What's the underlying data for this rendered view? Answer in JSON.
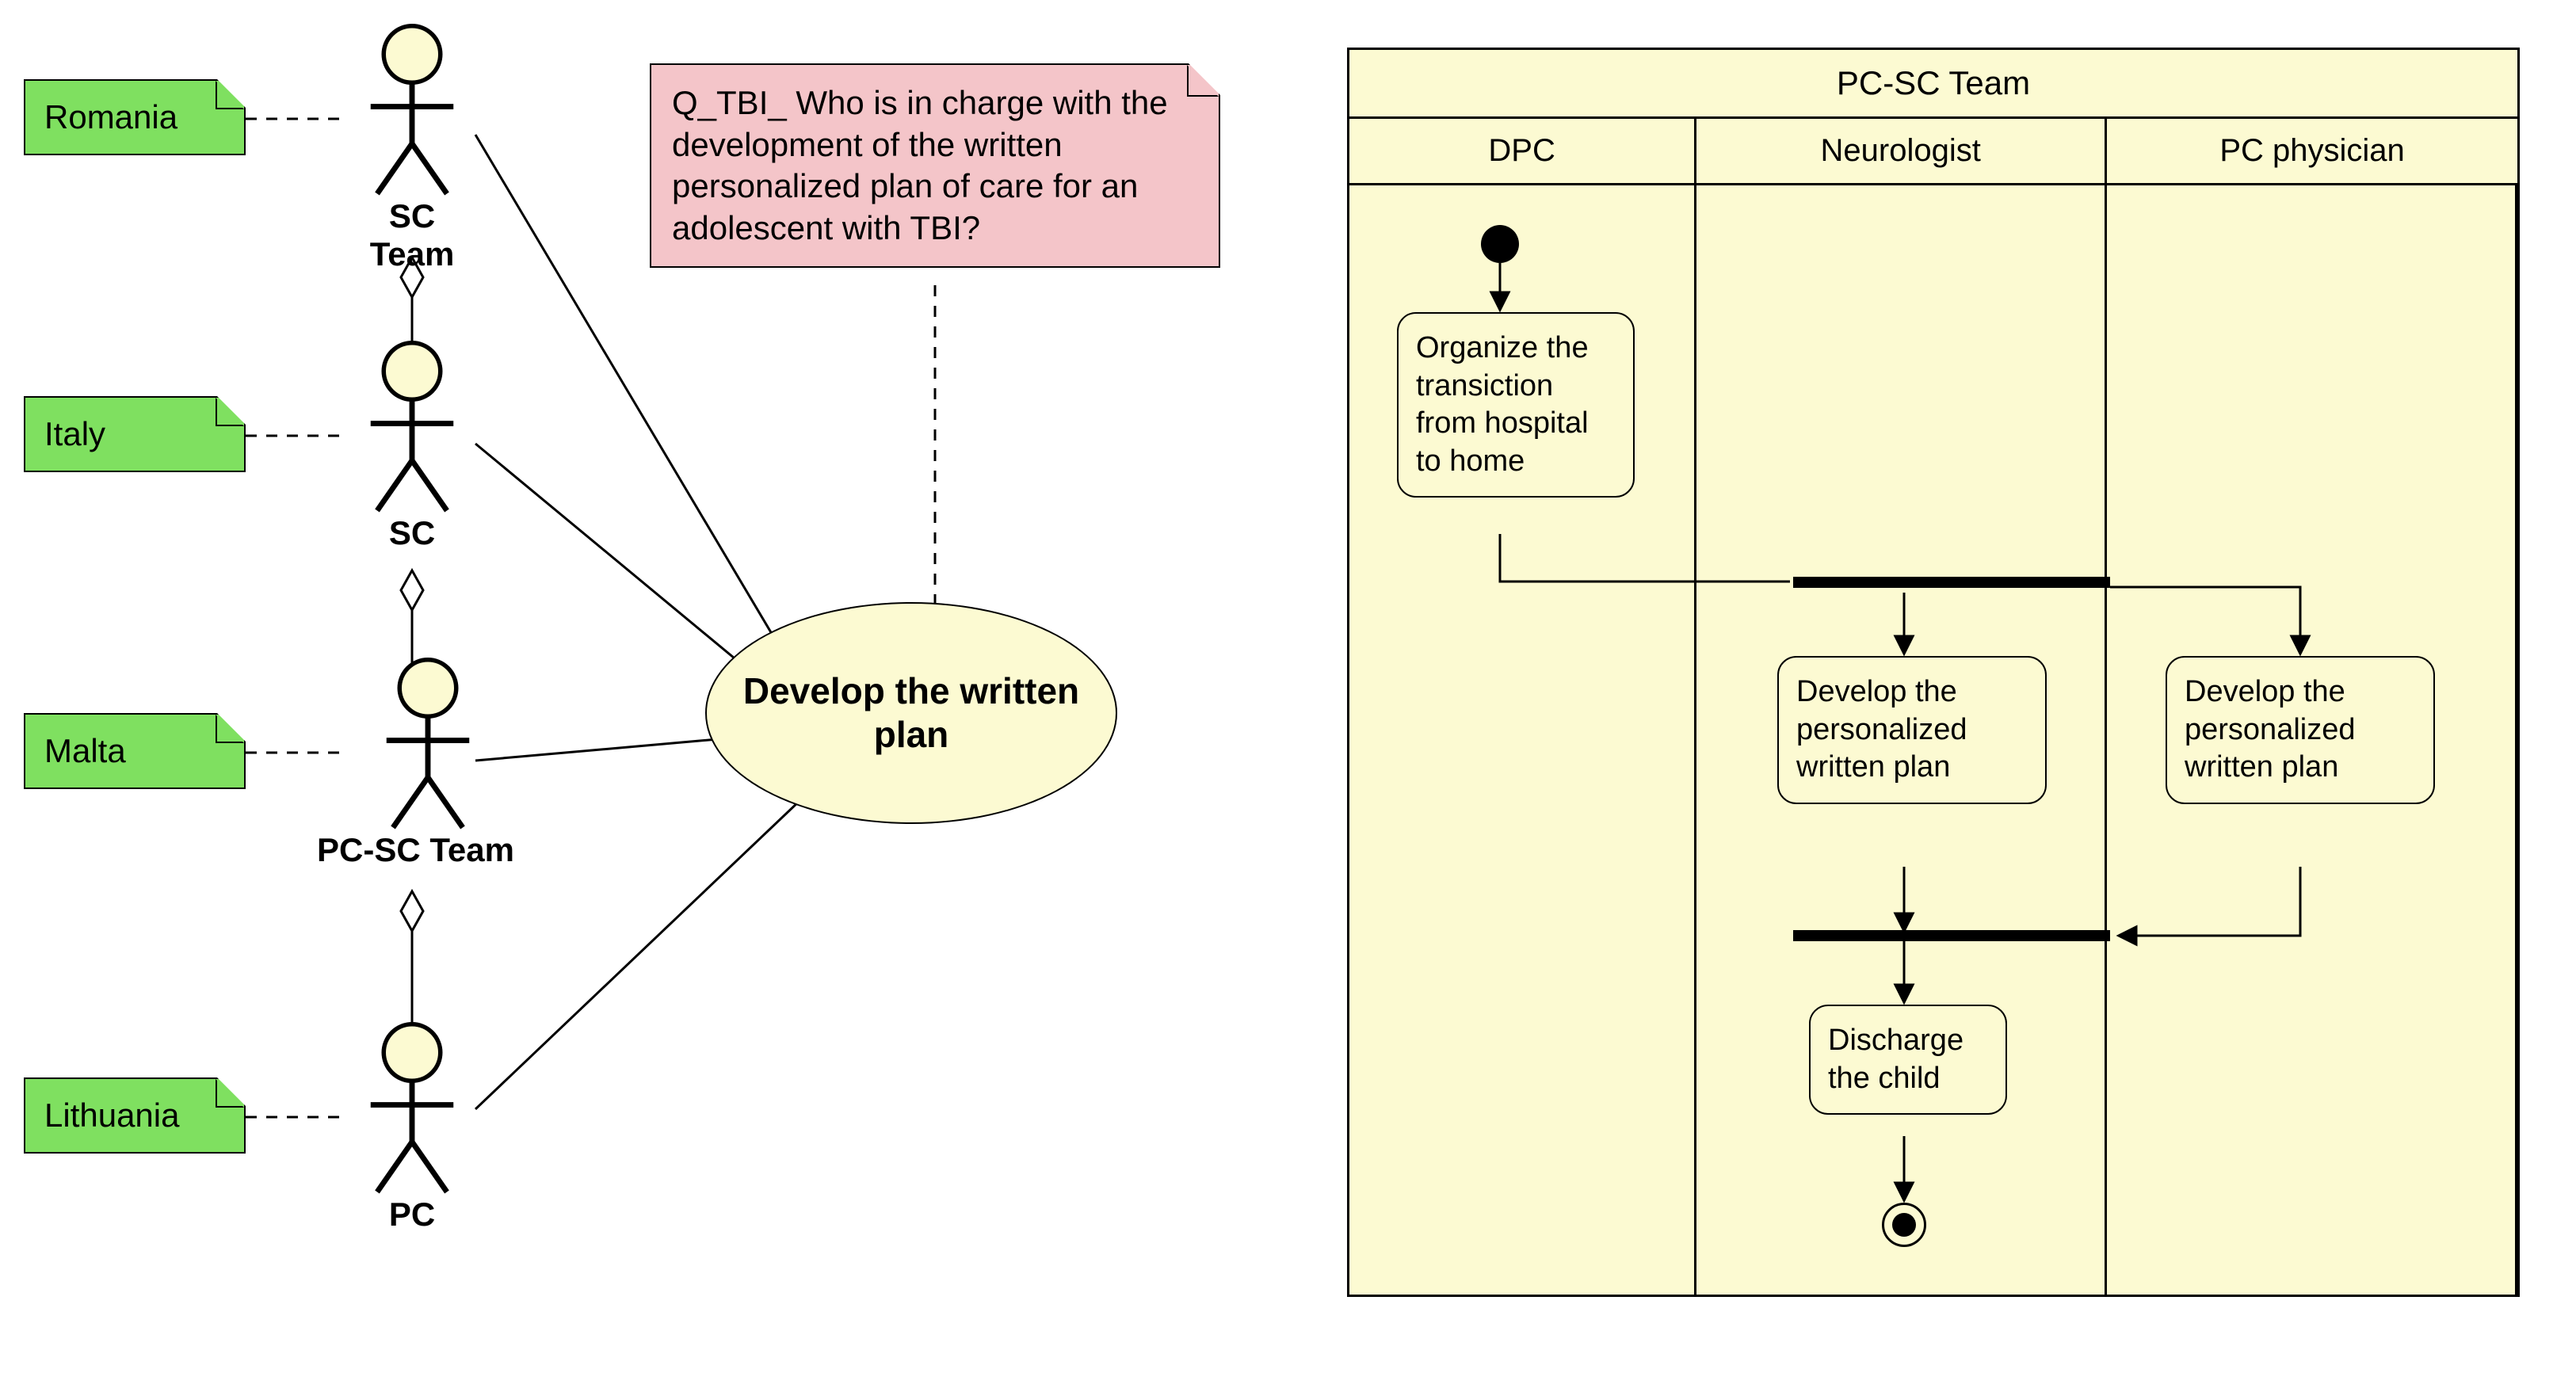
{
  "colors": {
    "noteGreen": "#7FE060",
    "notePink": "#F4C5C9",
    "fillYellow": "#FCFAD2",
    "stroke": "#000000"
  },
  "left": {
    "notes": {
      "romania": "Romania",
      "italy": "Italy",
      "malta": "Malta",
      "lithuania": "Lithuania"
    },
    "actors": {
      "scTeam": "SC Team",
      "sc": "SC",
      "pcScTeam": "PC-SC Team",
      "pc": "PC"
    },
    "usecase": "Develop the written plan",
    "pinkNote": "Q_TBI_ Who is in charge with the development of the written personalized plan of care for an adolescent with TBI?"
  },
  "right": {
    "title": "PC-SC Team",
    "lanes": {
      "dpc": "DPC",
      "neurologist": "Neurologist",
      "pcPhysician": "PC physician"
    },
    "activities": {
      "organize": "Organize the transiction from hospital to home",
      "developNeuro": "Develop the personalized written plan",
      "developPc": "Develop the personalized written plan",
      "discharge": "Discharge the child"
    }
  }
}
